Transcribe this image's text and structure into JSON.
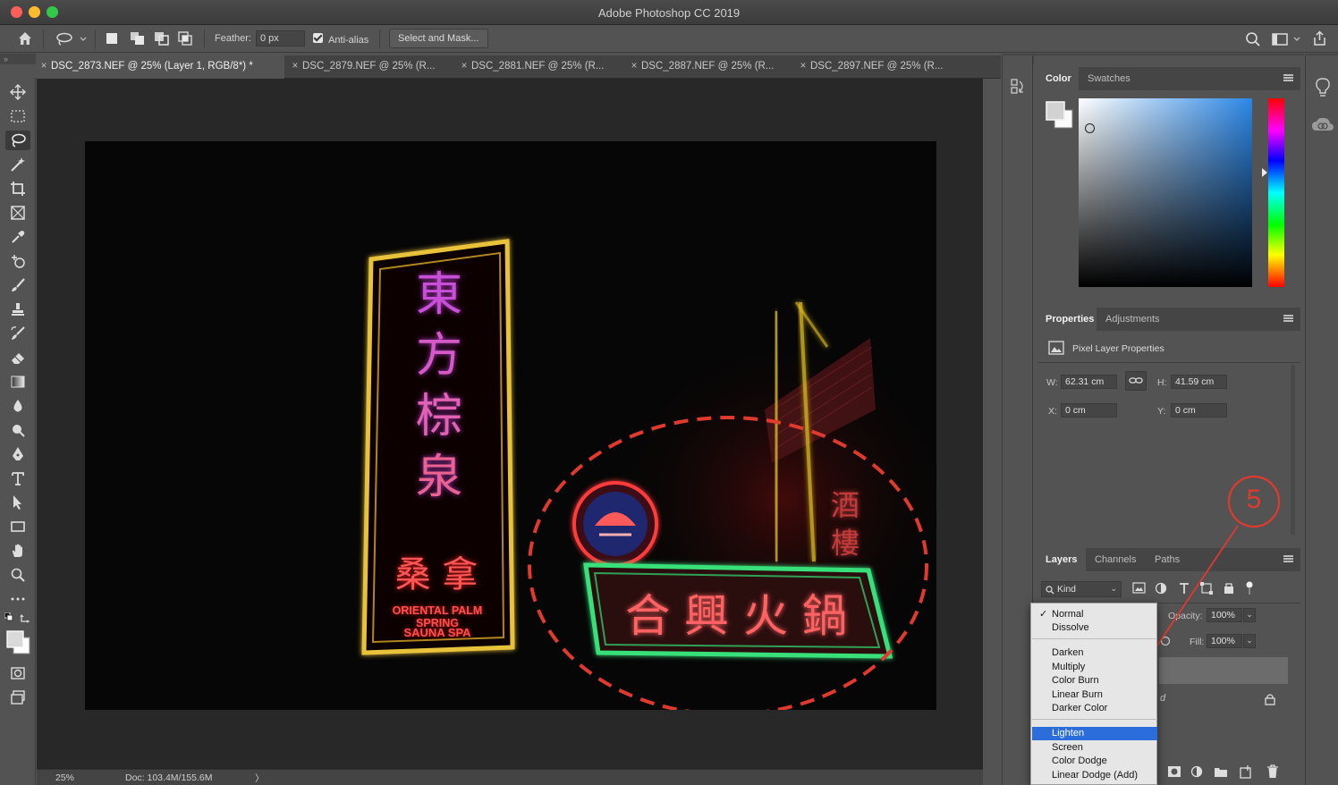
{
  "window": {
    "title": "Adobe Photoshop CC 2019"
  },
  "options_bar": {
    "feather_label": "Feather:",
    "feather_value": "0 px",
    "anti_alias_label": "Anti-alias",
    "anti_alias_checked": true,
    "select_mask_label": "Select and Mask..."
  },
  "tabs": [
    {
      "label": "DSC_2873.NEF @ 25% (Layer 1, RGB/8*) *",
      "active": true
    },
    {
      "label": "DSC_2879.NEF @ 25% (R...",
      "active": false
    },
    {
      "label": "DSC_2881.NEF @ 25% (R...",
      "active": false
    },
    {
      "label": "DSC_2887.NEF @ 25% (R...",
      "active": false
    },
    {
      "label": "DSC_2897.NEF @ 25% (R...",
      "active": false
    }
  ],
  "tools": [
    "move-tool",
    "marquee-tool",
    "lasso-tool",
    "magic-wand-tool",
    "crop-tool",
    "frame-tool",
    "eyedropper-tool",
    "healing-brush-tool",
    "brush-tool",
    "clone-stamp-tool",
    "history-brush-tool",
    "eraser-tool",
    "gradient-tool",
    "blur-tool",
    "dodge-tool",
    "pen-tool",
    "type-tool",
    "path-selection-tool",
    "rectangle-tool",
    "hand-tool",
    "zoom-tool",
    "more-tools"
  ],
  "canvas": {
    "sign_vertical_chars": [
      "東",
      "方",
      "棕",
      "泉"
    ],
    "sign_vertical_sub": "桑 拿",
    "sign_english_1": "ORIENTAL PALM SPRING",
    "sign_english_2": "SAUNA SPA",
    "sign_horizontal_chars": "合 興 火 鍋",
    "sign_side_chars": "酒 樓",
    "annotation_number": "5",
    "accent_red": "#e03a2f"
  },
  "status_bar": {
    "zoom": "25%",
    "doc": "Doc: 103.4M/155.6M"
  },
  "color_panel": {
    "tabs": [
      "Color",
      "Swatches"
    ],
    "active_tab": "Color"
  },
  "properties_panel": {
    "tabs": [
      "Properties",
      "Adjustments"
    ],
    "title": "Pixel Layer Properties",
    "w_label": "W:",
    "w_value": "62.31 cm",
    "h_label": "H:",
    "h_value": "41.59 cm",
    "x_label": "X:",
    "x_value": "0 cm",
    "y_label": "Y:",
    "y_value": "0 cm"
  },
  "layers_panel": {
    "tabs": [
      "Layers",
      "Channels",
      "Paths"
    ],
    "kind_label": "Kind",
    "opacity_label": "Opacity:",
    "opacity_value": "100%",
    "fill_label": "Fill:",
    "fill_value": "100%",
    "layer_trailing_letter": "d"
  },
  "blend_menu": {
    "items": [
      {
        "label": "Normal",
        "checked": true,
        "selected": false
      },
      {
        "label": "Dissolve",
        "checked": false,
        "selected": false
      },
      {
        "label": "Darken",
        "checked": false,
        "selected": false
      },
      {
        "label": "Multiply",
        "checked": false,
        "selected": false
      },
      {
        "label": "Color Burn",
        "checked": false,
        "selected": false
      },
      {
        "label": "Linear Burn",
        "checked": false,
        "selected": false
      },
      {
        "label": "Darker Color",
        "checked": false,
        "selected": false
      },
      {
        "label": "Lighten",
        "checked": false,
        "selected": true
      },
      {
        "label": "Screen",
        "checked": false,
        "selected": false
      },
      {
        "label": "Color Dodge",
        "checked": false,
        "selected": false
      },
      {
        "label": "Linear Dodge (Add)",
        "checked": false,
        "selected": false
      }
    ],
    "check_glyph": "✓"
  },
  "strip_glyphs": {
    "expand": "»",
    "collapse": "«"
  }
}
